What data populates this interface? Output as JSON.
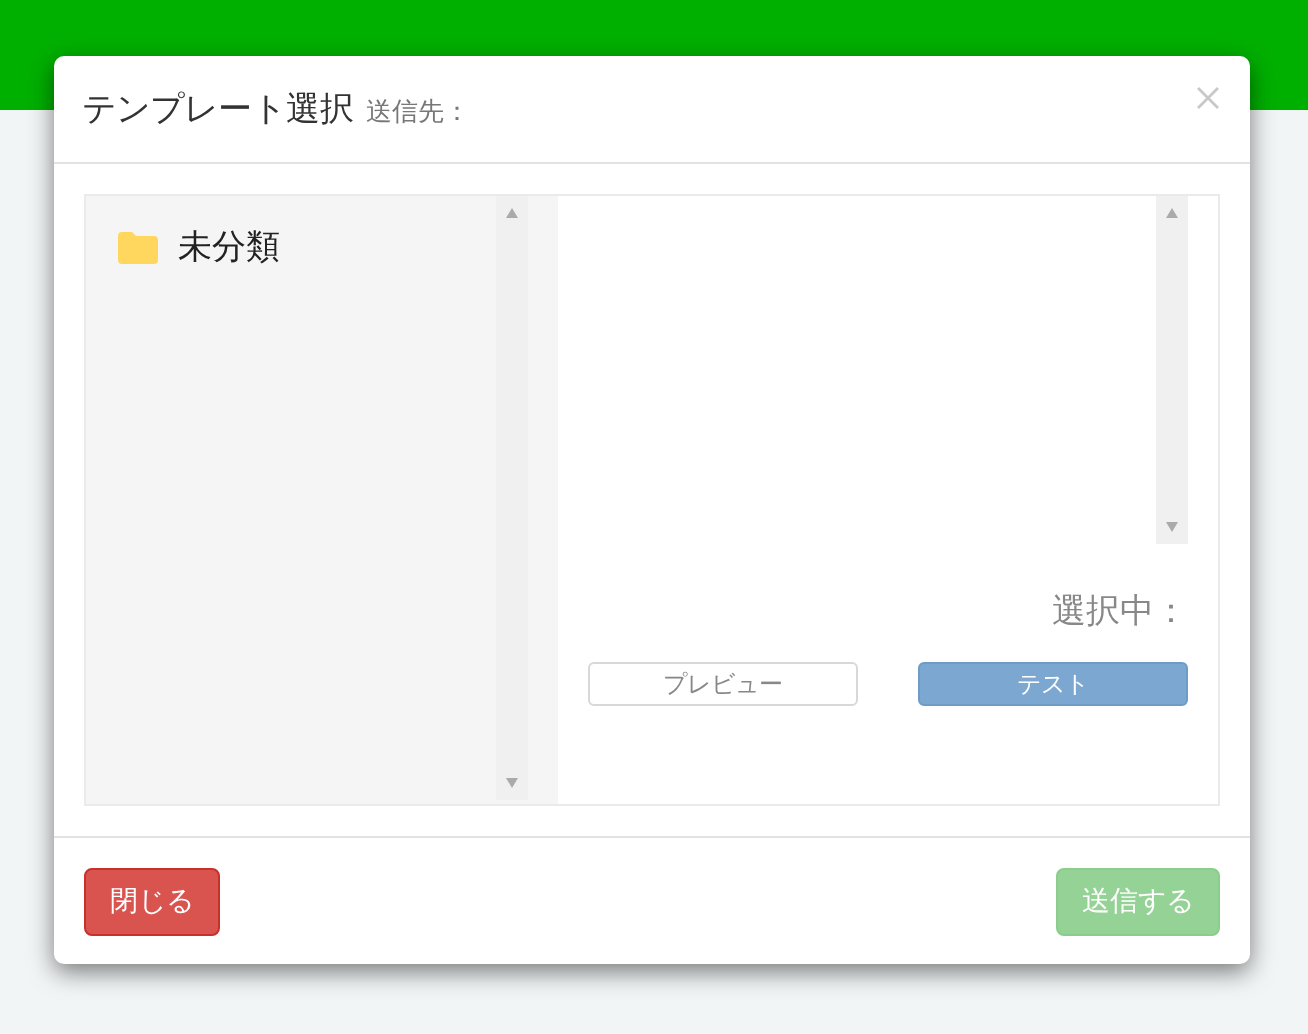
{
  "dialog": {
    "title": "テンプレート選択",
    "recipient_label": "送信先："
  },
  "folders": [
    {
      "name": "未分類",
      "selected": false
    }
  ],
  "preview": {
    "selection_label": "選択中："
  },
  "actions": [
    {
      "label": "プレビュー",
      "kind": "outline"
    },
    {
      "label": "テスト",
      "kind": "primary"
    }
  ],
  "footer": {
    "close": {
      "label": "閉じる"
    },
    "send": {
      "label": "送信する",
      "disabled": true
    }
  }
}
